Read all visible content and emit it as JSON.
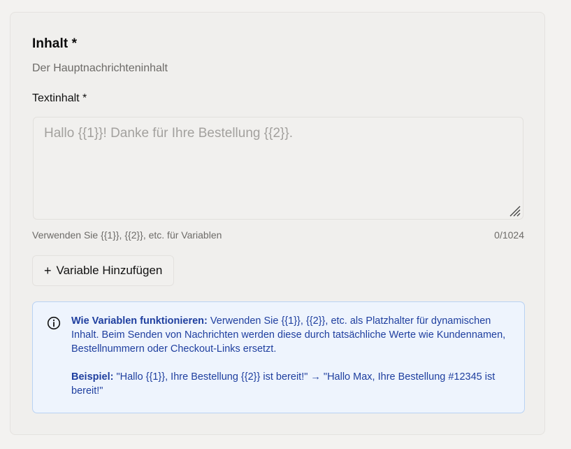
{
  "section": {
    "title": "Inhalt *",
    "subtitle": "Der Hauptnachrichteninhalt"
  },
  "text_field": {
    "label": "Textinhalt *",
    "value": "",
    "placeholder": "Hallo {{1}}! Danke für Ihre Bestellung {{2}}.",
    "hint": "Verwenden Sie {{1}}, {{2}}, etc. für Variablen",
    "counter": "0/1024"
  },
  "add_variable_button": {
    "icon": "+",
    "label": "Variable Hinzufügen"
  },
  "info_box": {
    "icon": "info-circle-icon",
    "how_heading": "Wie Variablen funktionieren:",
    "how_text": " Verwenden Sie {{1}}, {{2}}, etc. als Platzhalter für dynamischen Inhalt. Beim Senden von Nachrichten werden diese durch tatsächliche Werte wie Kundennamen, Bestellnummern oder Checkout-Links ersetzt.",
    "example_heading": "Beispiel:",
    "example_text": " \"Hallo {{1}}, Ihre Bestellung {{2}} ist bereit!\" → \"Hallo Max, Ihre Bestellung #12345 ist bereit!\""
  },
  "colors": {
    "info_text": "#1f3f9f",
    "info_background": "#eef4fd",
    "info_border": "#b9d2f3"
  }
}
